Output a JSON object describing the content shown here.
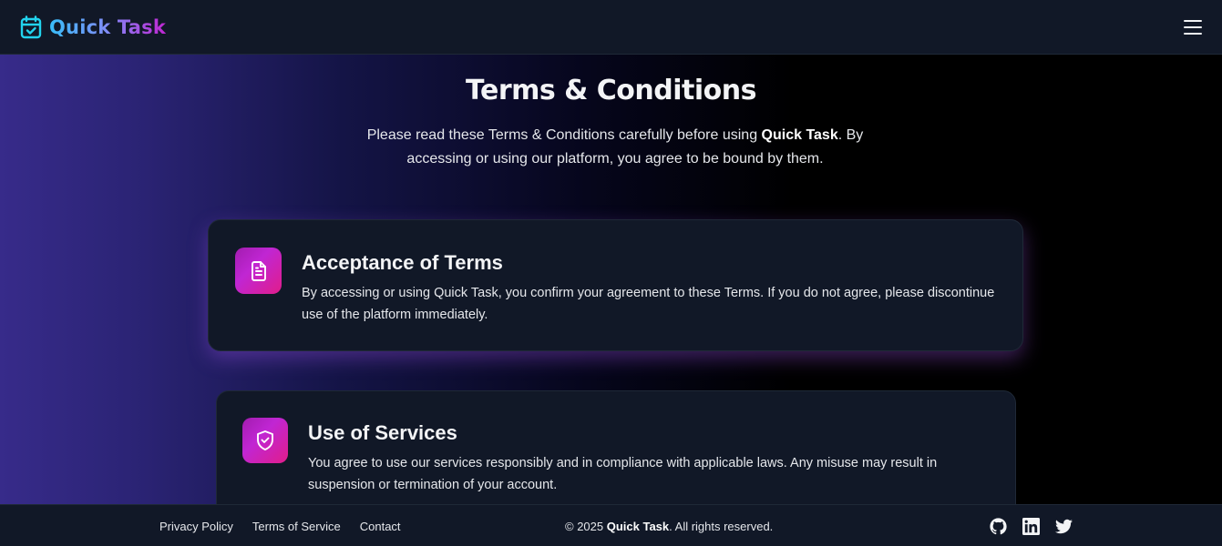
{
  "header": {
    "brand": "Quick Task",
    "brand_icon": "calendar-check-icon",
    "menu_icon": "hamburger-menu-icon"
  },
  "hero": {
    "title": "Terms & Conditions",
    "intro_before": "Please read these Terms & Conditions carefully before using ",
    "intro_brand": "Quick Task",
    "intro_after": ". By accessing or using our platform, you agree to be bound by them."
  },
  "sections": [
    {
      "icon": "document-icon",
      "title": "Acceptance of Terms",
      "text": "By accessing or using Quick Task, you confirm your agreement to these Terms. If you do not agree, please discontinue use of the platform immediately."
    },
    {
      "icon": "shield-check-icon",
      "title": "Use of Services",
      "text": "You agree to use our services responsibly and in compliance with applicable laws. Any misuse may result in suspension or termination of your account."
    }
  ],
  "footer": {
    "links": [
      "Privacy Policy",
      "Terms of Service",
      "Contact"
    ],
    "copyright_before": "© 2025 ",
    "copyright_brand": "Quick Task",
    "copyright_after": ". All rights reserved.",
    "socials": [
      "github-icon",
      "linkedin-icon",
      "twitter-icon"
    ]
  },
  "colors": {
    "accent_start": "#38bdf8",
    "accent_end": "#c026d3",
    "icon_gradient_start": "#a21caf",
    "icon_gradient_end": "#e11d8a",
    "panel": "#111827"
  }
}
